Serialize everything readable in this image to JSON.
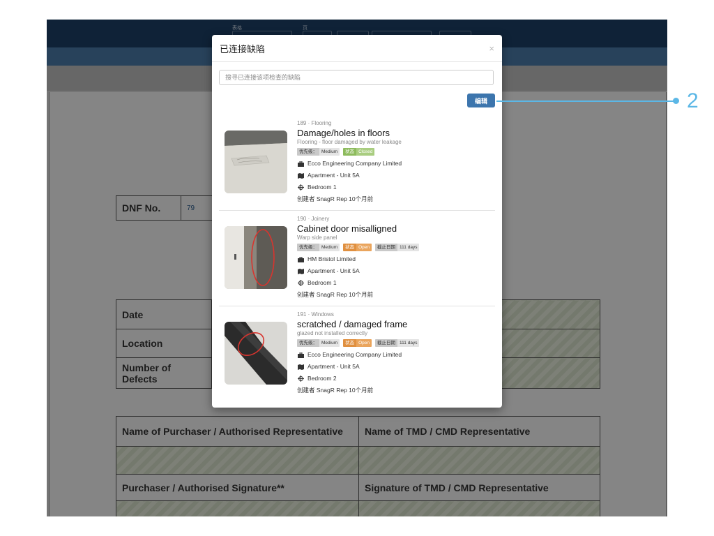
{
  "topbar": {
    "label_form": "表格",
    "label_page": "页"
  },
  "document": {
    "dnf_label": "DNF No.",
    "dnf_value": "79",
    "date_label": "Date",
    "location_label": "Location",
    "defects_label": "Number of Defects",
    "purchaser_rep_label": "Name of Purchaser / Authorised Representative",
    "tmd_rep_label": "Name of TMD / CMD Representative",
    "purchaser_sig_label": "Purchaser / Authorised Signature**",
    "tmd_sig_label": "Signature of TMD / CMD Representative"
  },
  "modal": {
    "title": "已连接缺陷",
    "close": "×",
    "search_placeholder": "搜寻已连接该项检查的缺陷",
    "edit_label": "编辑",
    "priority_key": "优先级：",
    "status_key": "状态",
    "due_key": "截止日期",
    "defects": [
      {
        "category": "189 · Flooring",
        "title": "Damage/holes in floors",
        "subtitle": "Flooring - floor damaged by water leakage",
        "priority": "Medium",
        "status": "Closed",
        "company": "Ecco Engineering Company Limited",
        "unit": "Apartment - Unit 5A",
        "room": "Bedroom 1",
        "creator": "创建者 SnagR Rep 10个月前"
      },
      {
        "category": "190 · Joinery",
        "title": "Cabinet door misalligned",
        "subtitle": "Warp side panel",
        "priority": "Medium",
        "status": "Open",
        "due": "111 days",
        "company": "HM Bristol Limited",
        "unit": "Apartment - Unit 5A",
        "room": "Bedroom 1",
        "creator": "创建者 SnagR Rep 10个月前"
      },
      {
        "category": "191 · Windows",
        "title": "scratched / damaged frame",
        "subtitle": "glazed not installed correctly",
        "priority": "Medium",
        "status": "Open",
        "due": "111 days",
        "company": "Ecco Engineering Company Limited",
        "unit": "Apartment - Unit 5A",
        "room": "Bedroom 2",
        "creator": "创建者 SnagR Rep 10个月前"
      }
    ]
  },
  "callout": {
    "number": "2",
    "color": "#5bb7e6"
  }
}
